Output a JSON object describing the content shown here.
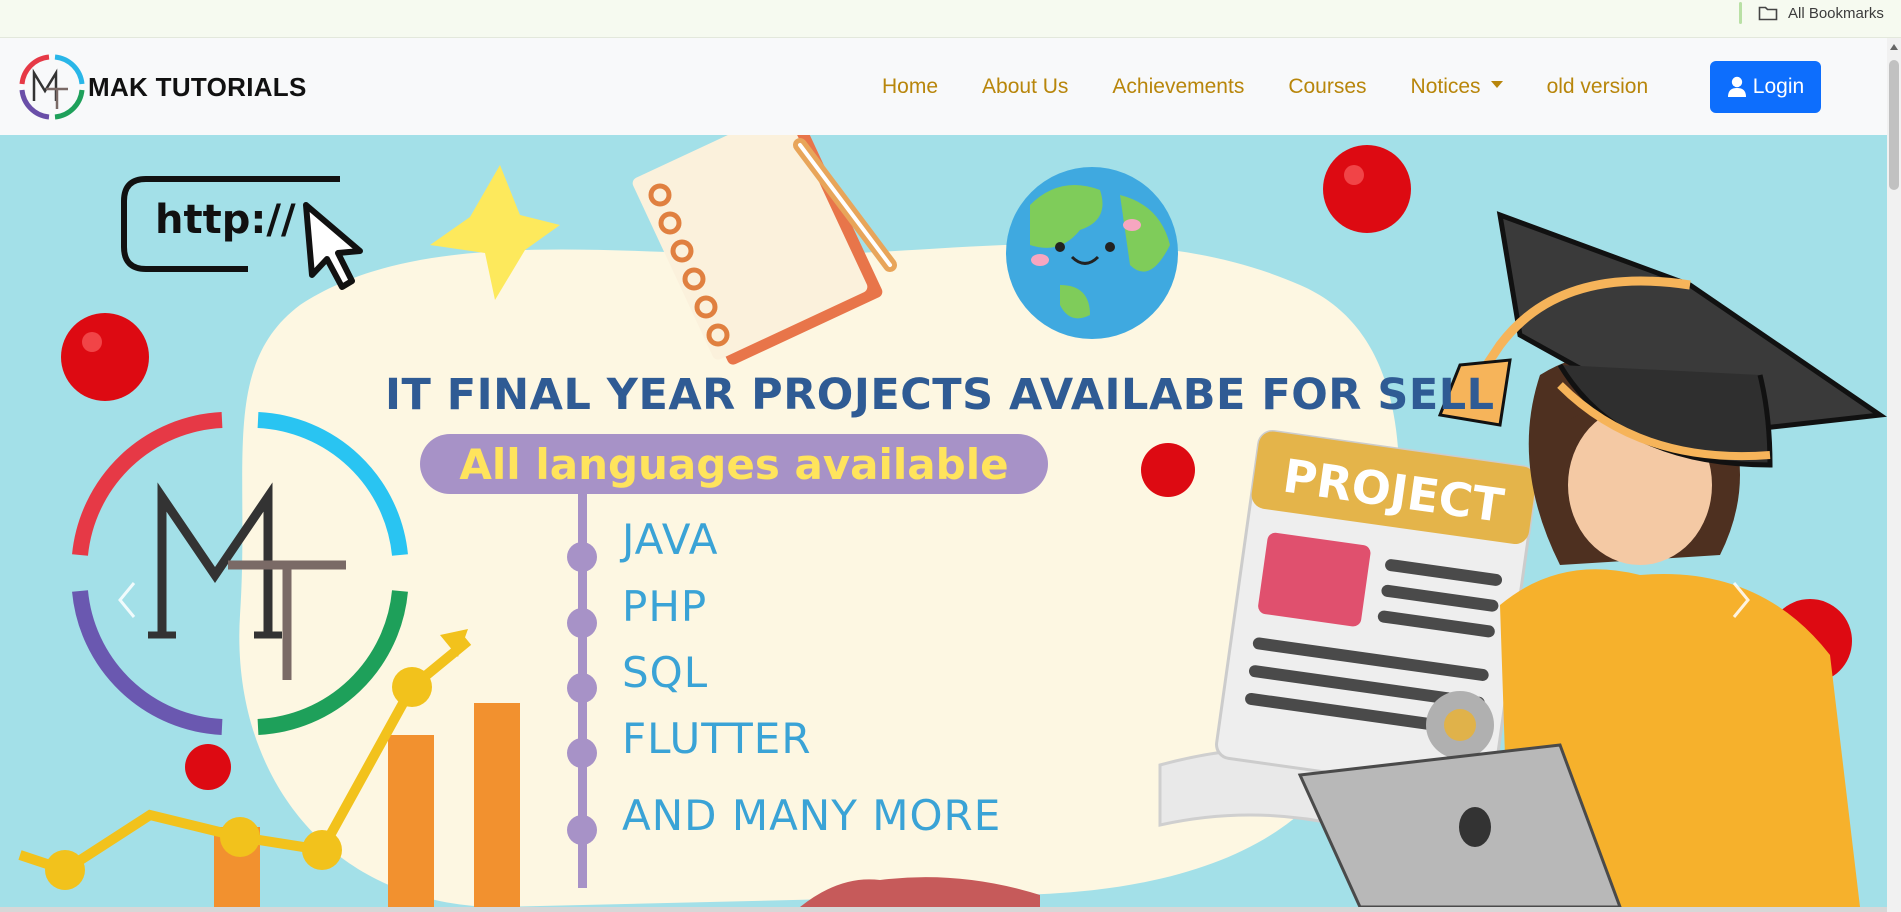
{
  "bookmarks_bar": {
    "all_bookmarks_label": "All Bookmarks",
    "icon": "folder-icon"
  },
  "navbar": {
    "brand_name": "MAK TUTORIALS",
    "logo_letters": "MT",
    "links": [
      {
        "label": "Home"
      },
      {
        "label": "About Us"
      },
      {
        "label": "Achievements"
      },
      {
        "label": "Courses"
      },
      {
        "label": "Notices",
        "dropdown": true
      },
      {
        "label": "old version"
      }
    ],
    "login_label": "Login",
    "login_icon": "user-icon"
  },
  "hero": {
    "url_text": "http://",
    "headline": "IT FINAL YEAR PROJECTS AVAILABE FOR SELL",
    "languages_pill": "All languages available",
    "languages": [
      "JAVA",
      "PHP",
      "SQL",
      "FLUTTER",
      "AND MANY MORE"
    ],
    "project_card_label": "PROJECT",
    "prev_icon": "chevron-left-icon",
    "next_icon": "chevron-right-icon"
  },
  "colors": {
    "nav_link": "#b8860b",
    "login_bg": "#0d6efd",
    "hero_bg": "#a3e0e8",
    "headline": "#2f5b94",
    "pill_bg": "#a792c7",
    "pill_text": "#ffe45c",
    "language_text": "#3aa3d6"
  }
}
